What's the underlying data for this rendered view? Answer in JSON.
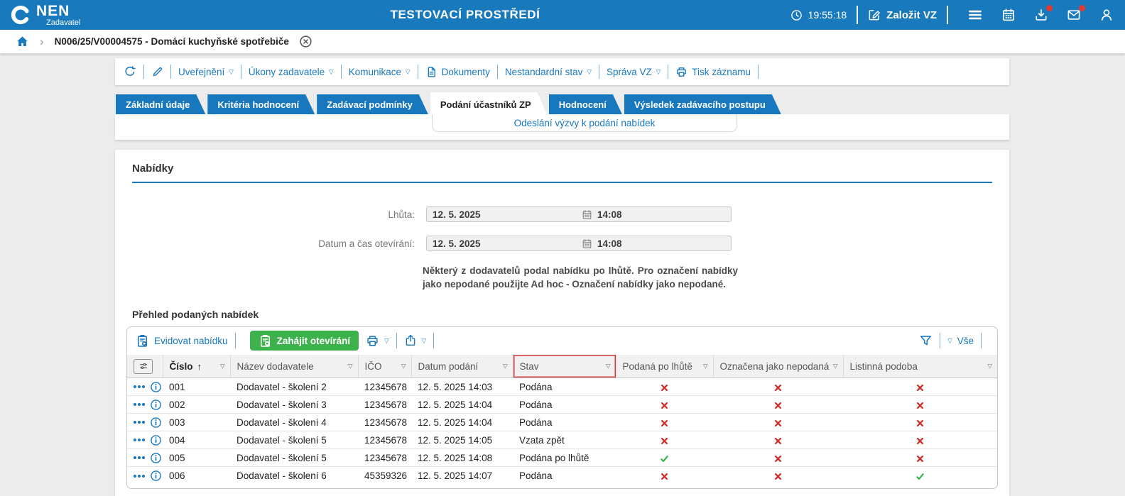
{
  "header": {
    "brand": "NEN",
    "brand_sub": "Zadavatel",
    "title": "TESTOVACÍ PROSTŘEDÍ",
    "time": "19:55:18",
    "create_vz_label": "Založit VZ"
  },
  "breadcrumb": {
    "item": "N006/25/V00004575 - Domácí kuchyňské spotřebiče"
  },
  "record_toolbar": {
    "items": [
      {
        "label": "Uveřejnění",
        "dropdown": true
      },
      {
        "label": "Úkony zadavatele",
        "dropdown": true
      },
      {
        "label": "Komunikace",
        "dropdown": true
      },
      {
        "label": "Dokumenty",
        "icon": "document"
      },
      {
        "label": "Nestandardní stav",
        "dropdown": true
      },
      {
        "label": "Správa VZ",
        "dropdown": true
      },
      {
        "label": "Tisk záznamu",
        "icon": "printer"
      }
    ]
  },
  "tabs": [
    {
      "label": "Základní údaje",
      "active": false
    },
    {
      "label": "Kritéria hodnocení",
      "active": false
    },
    {
      "label": "Zadávací podmínky",
      "active": false
    },
    {
      "label": "Podání účastníků ZP",
      "active": true
    },
    {
      "label": "Hodnocení",
      "active": false
    },
    {
      "label": "Výsledek zadávacího postupu",
      "active": false
    }
  ],
  "tab_dropdown": {
    "link": "Odeslání výzvy k podání nabídek"
  },
  "offers": {
    "section_title": "Nabídky",
    "fields": [
      {
        "label": "Lhůta:",
        "date": "12. 5. 2025",
        "time": "14:08"
      },
      {
        "label": "Datum a čas otevírání:",
        "date": "12. 5. 2025",
        "time": "14:08"
      }
    ],
    "warning": "Některý z dodavatelů podal nabídku po lhůtě. Pro označení nabídky jako nepodané použijte Ad hoc - Označení nabídky jako nepodané.",
    "table_title": "Přehled podaných nabídek",
    "grid_toolbar": {
      "evidovat_label": "Evidovat nabídku",
      "zahajit_label": "Zahájit otevírání",
      "vse_label": "Vše"
    },
    "table": {
      "columns": [
        {
          "label": "Číslo",
          "sorted": "asc"
        },
        {
          "label": "Název dodavatele"
        },
        {
          "label": "IČO"
        },
        {
          "label": "Datum podání"
        },
        {
          "label": "Stav",
          "highlighted": true
        },
        {
          "label": "Podaná po lhůtě"
        },
        {
          "label": "Označena jako nepodaná"
        },
        {
          "label": "Listinná podoba"
        }
      ],
      "rows": [
        {
          "cislo": "001",
          "nazev": "Dodavatel - školení 2",
          "ico": "12345678",
          "datum": "12. 5. 2025 14:03",
          "stav": "Podána",
          "podana_po_lhute": false,
          "oznacena_jako_nepodana": false,
          "listinna_podoba": false
        },
        {
          "cislo": "002",
          "nazev": "Dodavatel - školení 3",
          "ico": "12345678",
          "datum": "12. 5. 2025 14:04",
          "stav": "Podána",
          "podana_po_lhute": false,
          "oznacena_jako_nepodana": false,
          "listinna_podoba": false
        },
        {
          "cislo": "003",
          "nazev": "Dodavatel - školení 4",
          "ico": "12345678",
          "datum": "12. 5. 2025 14:04",
          "stav": "Podána",
          "podana_po_lhute": false,
          "oznacena_jako_nepodana": false,
          "listinna_podoba": false
        },
        {
          "cislo": "004",
          "nazev": "Dodavatel - školení 5",
          "ico": "12345678",
          "datum": "12. 5. 2025 14:05",
          "stav": "Vzata zpět",
          "podana_po_lhute": false,
          "oznacena_jako_nepodana": false,
          "listinna_podoba": false
        },
        {
          "cislo": "005",
          "nazev": "Dodavatel - školení 5",
          "ico": "12345678",
          "datum": "12. 5. 2025 14:08",
          "stav": "Podána po lhůtě",
          "podana_po_lhute": true,
          "oznacena_jako_nepodana": false,
          "listinna_podoba": false
        },
        {
          "cislo": "006",
          "nazev": "Dodavatel - školení 6",
          "ico": "45359326",
          "datum": "12. 5. 2025 14:07",
          "stav": "Podána",
          "podana_po_lhute": false,
          "oznacena_jako_nepodana": false,
          "listinna_podoba": true
        }
      ]
    }
  },
  "icons": {
    "dropdown": "▽",
    "sort_asc": "↑",
    "breadcrumb_chevron": "›",
    "nen_ring": "ring-swoosh",
    "clock": "clock-face",
    "edit_square": "pencil-in-square",
    "hamburger": "menu-lines",
    "calendar": "calendar-grid",
    "download": "tray-arrow-down",
    "mail": "envelope",
    "person": "user-silhouette",
    "home": "house",
    "refresh": "circular-arrow",
    "pencil": "pencil",
    "document": "page",
    "printer": "printer",
    "share": "tray-arrow-up",
    "filter": "funnel",
    "clipboard_gear": "clipboard-with-gear",
    "sliders": "column-settings-sliders",
    "info": "circle-i",
    "close_circle": "circle-x",
    "cross_mark": "red-x",
    "check_mark": "green-check"
  },
  "colors": {
    "brand_blue": "#1879bd",
    "link_blue": "#1878be",
    "green": "#3cb14c",
    "cross_red": "#d02b2b",
    "check_green": "#35b34a",
    "highlight_red": "#d23b3b",
    "notification_red": "#e33a30",
    "page_bg": "#ececec"
  }
}
